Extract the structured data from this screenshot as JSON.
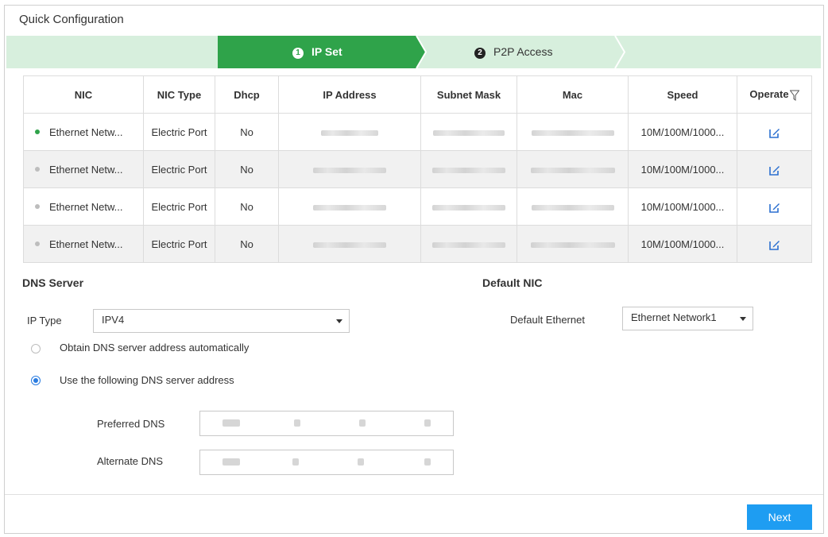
{
  "window": {
    "title": "Quick Configuration"
  },
  "steps": [
    {
      "number": "1",
      "label": "IP Set",
      "active": true
    },
    {
      "number": "2",
      "label": "P2P Access",
      "active": false
    }
  ],
  "table": {
    "headers": [
      "NIC",
      "NIC Type",
      "Dhcp",
      "IP Address",
      "Subnet Mask",
      "Mac",
      "Speed",
      "Operate"
    ],
    "rows": [
      {
        "nic": "Ethernet Netw...",
        "status": "connected",
        "nic_type": "Electric Port",
        "dhcp": "No",
        "speed": "10M/100M/1000..."
      },
      {
        "nic": "Ethernet Netw...",
        "status": "disconnected",
        "nic_type": "Electric Port",
        "dhcp": "No",
        "speed": "10M/100M/1000..."
      },
      {
        "nic": "Ethernet Netw...",
        "status": "disconnected",
        "nic_type": "Electric Port",
        "dhcp": "No",
        "speed": "10M/100M/1000..."
      },
      {
        "nic": "Ethernet Netw...",
        "status": "disconnected",
        "nic_type": "Electric Port",
        "dhcp": "No",
        "speed": "10M/100M/1000..."
      }
    ]
  },
  "dns": {
    "heading": "DNS Server",
    "ip_type_label": "IP Type",
    "ip_type_value": "IPV4",
    "option_auto": "Obtain DNS server address automatically",
    "option_manual": "Use the following DNS server address",
    "selected_option": "manual",
    "preferred_label": "Preferred DNS",
    "alternate_label": "Alternate DNS"
  },
  "default_nic": {
    "heading": "Default NIC",
    "label": "Default Ethernet",
    "value": "Ethernet Network1"
  },
  "footer": {
    "next_label": "Next"
  },
  "colors": {
    "active_step": "#2fa34a",
    "steps_bar": "#d7efdd",
    "connected_dot": "#2fa34a",
    "disconnected_dot": "#bdbdbd",
    "primary_button": "#1e9df2",
    "radio_selected": "#2a7ce0"
  },
  "icons": {
    "edit": "edit-icon",
    "filter": "filter-icon",
    "dropdown": "chevron-down-icon"
  }
}
